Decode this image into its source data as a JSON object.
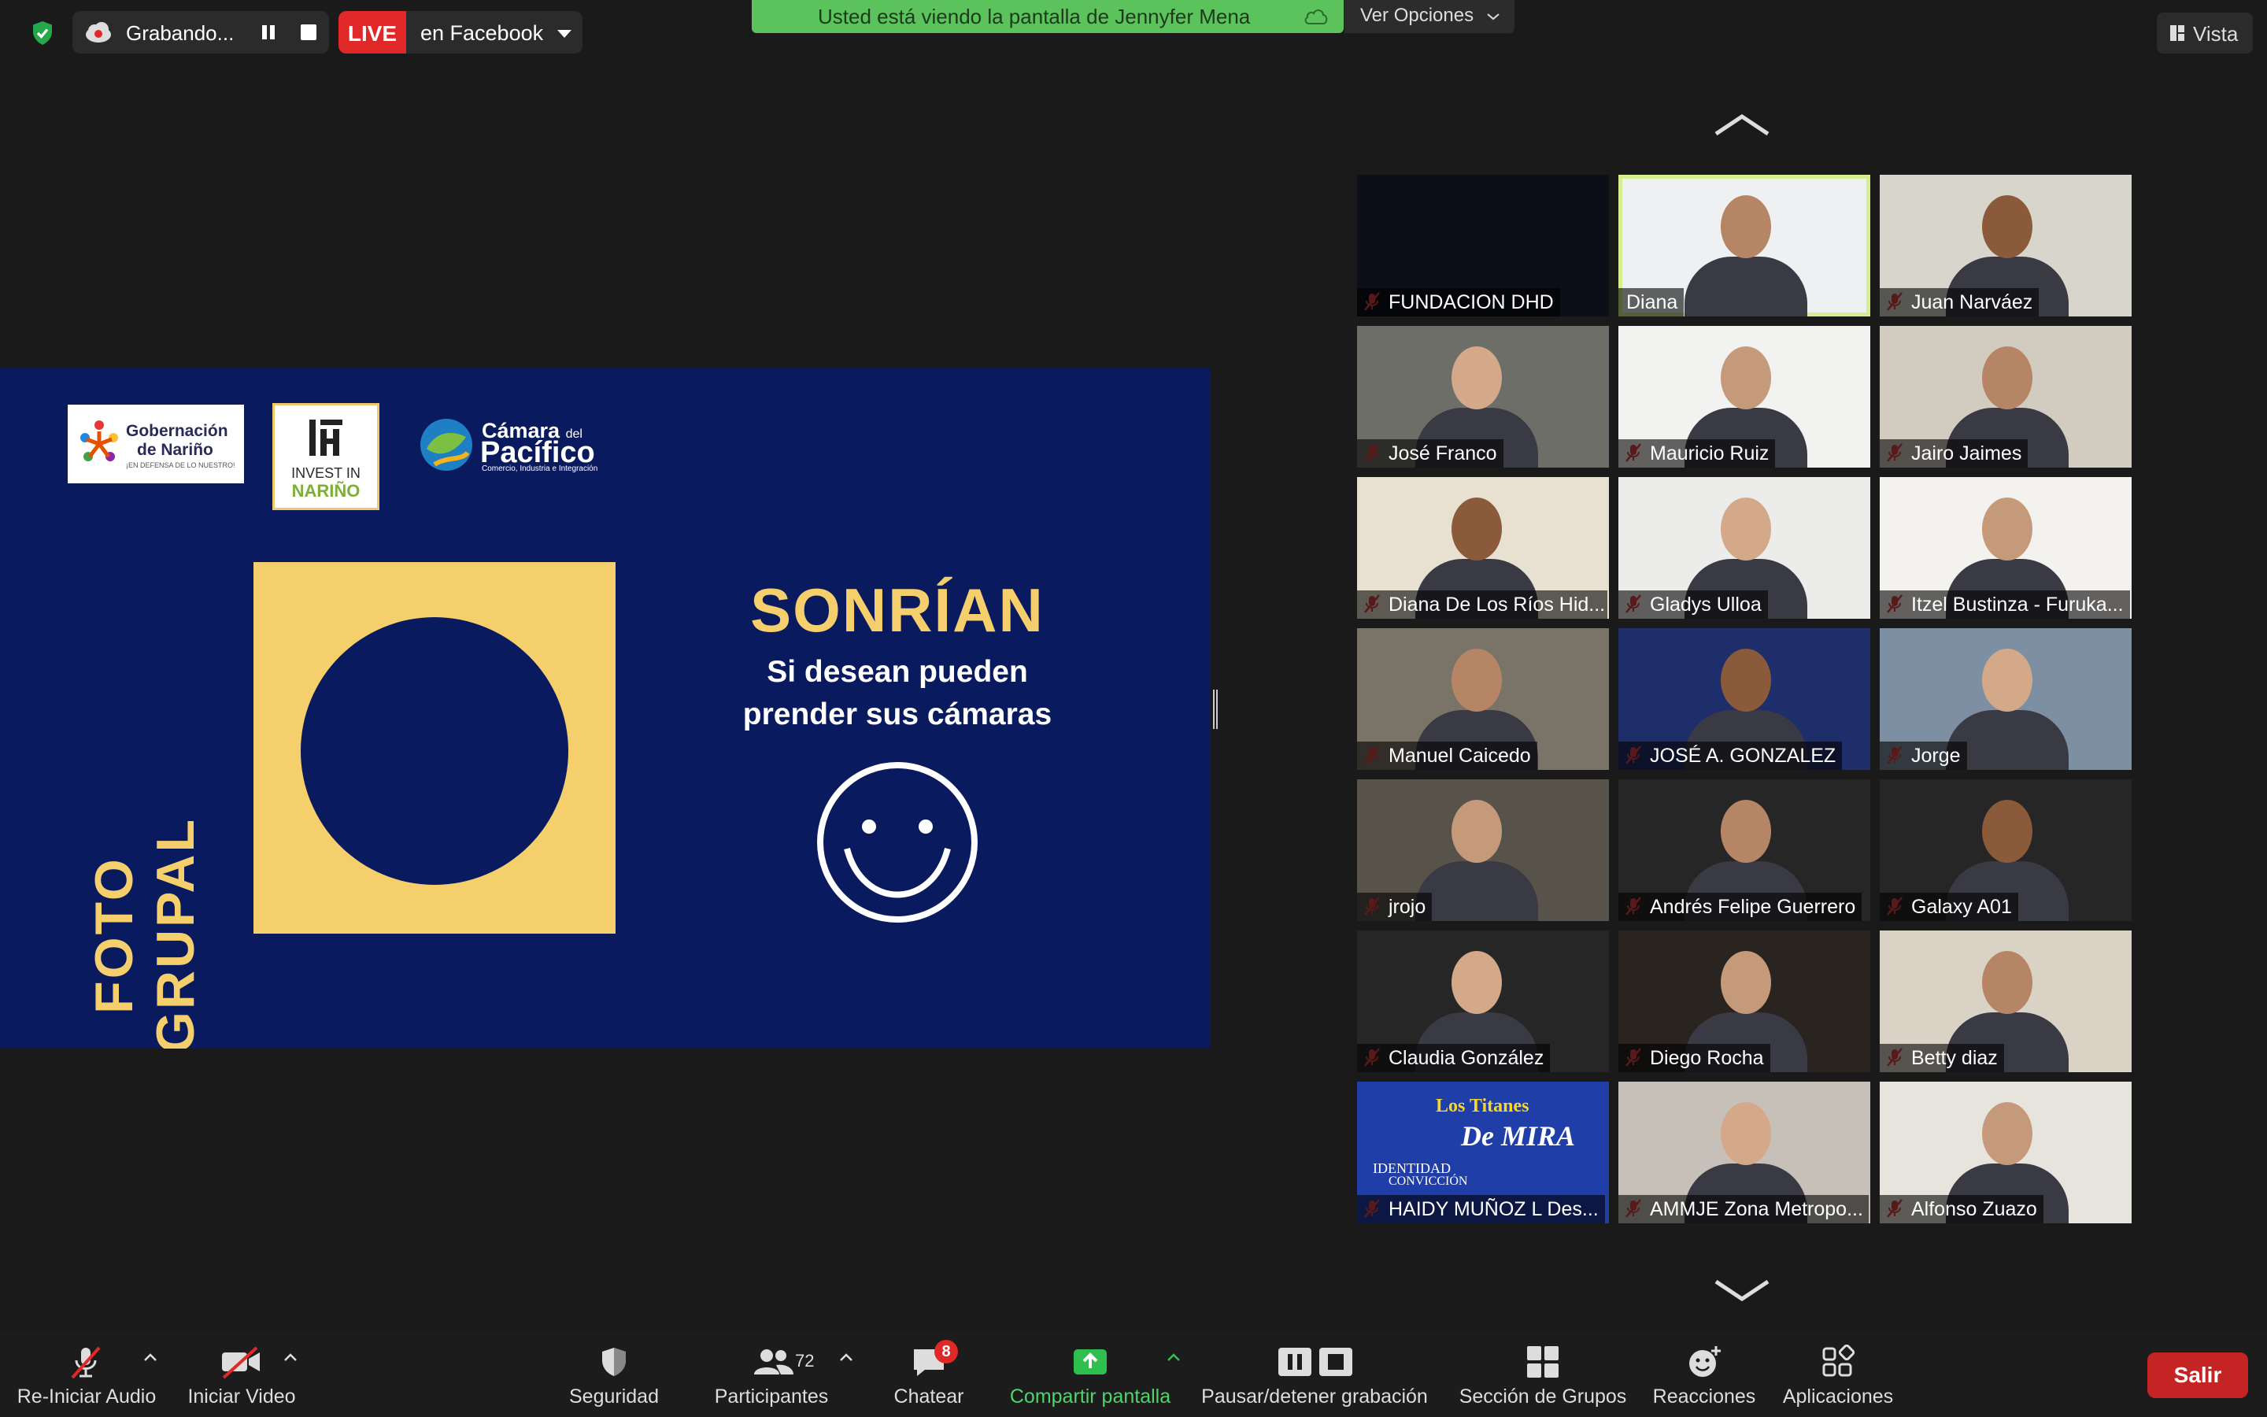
{
  "top_bar": {
    "recording_label": "Grabando...",
    "live_badge": "LIVE",
    "live_destination": "en Facebook",
    "share_banner": "Usted está viendo la pantalla de Jennyfer Mena",
    "view_options": "Ver Opciones",
    "view_button": "Vista"
  },
  "slide": {
    "logo_gob_line1": "Gobernación",
    "logo_gob_line2": "de Nariño",
    "logo_gob_tagline": "¡EN DEFENSA DE LO NUESTRO!",
    "logo_invest_line1": "INVEST IN",
    "logo_invest_line2": "NARIÑO",
    "logo_camara_line1": "Cámara",
    "logo_camara_del": "del",
    "logo_camara_line2": "Pacífico",
    "logo_camara_tagline": "Comercio, Industria e Integración",
    "vertical_title": "FOTO GRUPAL",
    "headline": "SONRÍAN",
    "subtitle_line1": "Si desean pueden",
    "subtitle_line2": "prender sus cámaras"
  },
  "participants": [
    {
      "name": "FUNDACION DHD",
      "muted": true
    },
    {
      "name": "Diana",
      "muted": false,
      "active": true
    },
    {
      "name": "Juan Narváez",
      "muted": true
    },
    {
      "name": "José Franco",
      "muted": true
    },
    {
      "name": "Mauricio Ruiz",
      "muted": true
    },
    {
      "name": "Jairo Jaimes",
      "muted": true
    },
    {
      "name": "Diana De Los Ríos Hid...",
      "muted": true
    },
    {
      "name": "Gladys Ulloa",
      "muted": true
    },
    {
      "name": "Itzel Bustinza - Furuka...",
      "muted": true
    },
    {
      "name": "Manuel Caicedo",
      "muted": true
    },
    {
      "name": "JOSÉ A. GONZALEZ",
      "muted": true
    },
    {
      "name": "Jorge",
      "muted": true
    },
    {
      "name": "jrojo",
      "muted": true
    },
    {
      "name": "Andrés Felipe Guerrero",
      "muted": true
    },
    {
      "name": "Galaxy A01",
      "muted": true
    },
    {
      "name": "Claudia González",
      "muted": true
    },
    {
      "name": "Diego Rocha",
      "muted": true
    },
    {
      "name": "Betty diaz",
      "muted": true
    },
    {
      "name": "HAIDY MUÑOZ L Des...",
      "muted": true
    },
    {
      "name": "AMMJE Zona Metropo...",
      "muted": true
    },
    {
      "name": "Alfonso Zuazo",
      "muted": true
    }
  ],
  "tile_overlays": {
    "haidy_line1": "Los Titanes",
    "haidy_line2": "De MIRA",
    "haidy_line3": "IDENTIDAD",
    "haidy_line4": "CONVICCIÓN"
  },
  "toolbar": {
    "audio": "Re-Iniciar Audio",
    "video": "Iniciar Video",
    "security": "Seguridad",
    "participants": "Participantes",
    "participants_count": "72",
    "chat": "Chatear",
    "chat_badge": "8",
    "share": "Compartir pantalla",
    "record": "Pausar/detener grabación",
    "breakout": "Sección de Grupos",
    "reactions": "Reacciones",
    "apps": "Aplicaciones",
    "leave": "Salir"
  },
  "colors": {
    "slide_bg": "#0a1a5e",
    "slide_yellow": "#f5cf6c",
    "banner_green": "#5cc25b",
    "live_red": "#e02828",
    "active_speaker": "#d4ef8d"
  }
}
